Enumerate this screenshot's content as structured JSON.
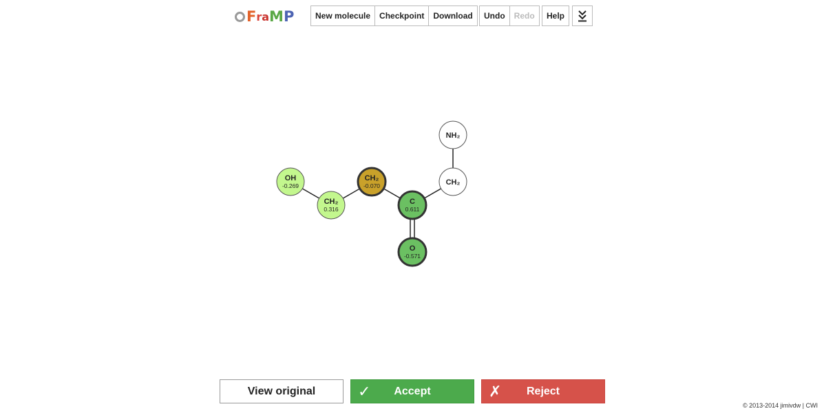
{
  "header": {
    "logo_ring": "O",
    "logo_f": "F",
    "logo_r": "r",
    "logo_a": "a",
    "logo_m": "M",
    "logo_p": "P",
    "group1": [
      "New molecule",
      "Checkpoint",
      "Download"
    ],
    "undo": "Undo",
    "redo": "Redo",
    "help": "Help",
    "expand_icon": "double-chevron-down-icon"
  },
  "molecule": {
    "atoms": [
      {
        "label": "OH",
        "charge": "-0.269",
        "color": "#c3f78e",
        "selected": false
      },
      {
        "label": "CH₂",
        "charge": "0.316",
        "color": "#c3f78e",
        "selected": false
      },
      {
        "label": "CH₂",
        "charge": "-0.070",
        "color": "#c9a12a",
        "selected": true
      },
      {
        "label": "C",
        "charge": "0.611",
        "color": "#6bc062",
        "selected": true
      },
      {
        "label": "O",
        "charge": "-0.571",
        "color": "#6bc062",
        "selected": true
      },
      {
        "label": "CH₂",
        "charge": "",
        "color": "#ffffff",
        "selected": false
      },
      {
        "label": "NH₂",
        "charge": "",
        "color": "#ffffff",
        "selected": false
      }
    ],
    "bonds": [
      {
        "from": 0,
        "to": 1,
        "order": 1
      },
      {
        "from": 1,
        "to": 2,
        "order": 1
      },
      {
        "from": 2,
        "to": 3,
        "order": 1
      },
      {
        "from": 3,
        "to": 4,
        "order": 2
      },
      {
        "from": 3,
        "to": 5,
        "order": 1
      },
      {
        "from": 5,
        "to": 6,
        "order": 1
      }
    ]
  },
  "actions": {
    "view_original": "View original",
    "accept": "Accept",
    "accept_glyph": "✓",
    "reject": "Reject",
    "reject_glyph": "✗"
  },
  "footer": {
    "copyright": "© 2013-2014 jimivdw | CWI"
  },
  "colors": {
    "accept": "#4caa4c",
    "reject": "#d6524a"
  }
}
